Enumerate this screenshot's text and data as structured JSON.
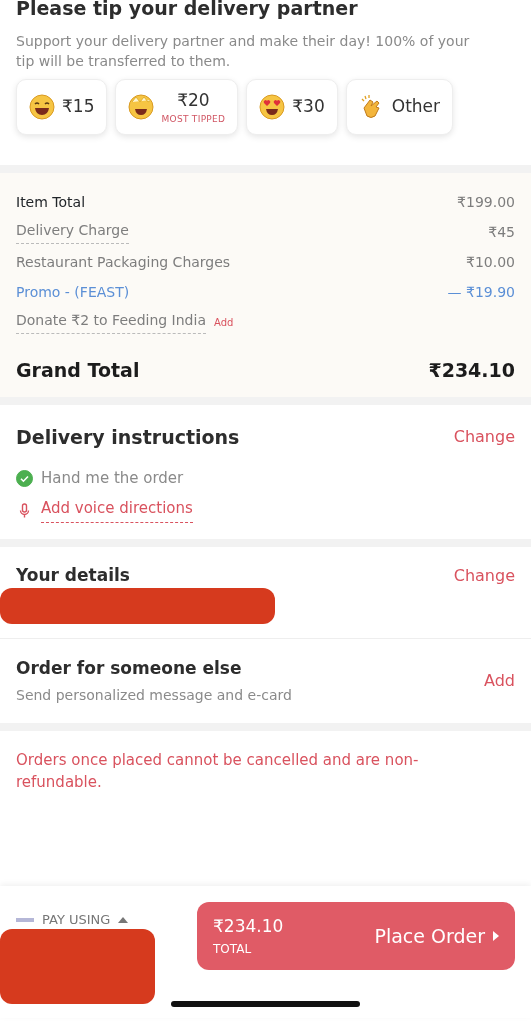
{
  "tip": {
    "title": "Please tip your delivery partner",
    "subtitle": "Support your delivery partner and make their day! 100% of your tip will be transferred to them.",
    "options": [
      {
        "kind": "laugh",
        "label": "₹15",
        "selected": false
      },
      {
        "kind": "star-eyes",
        "label": "₹20",
        "note": "MOST TIPPED",
        "selected": false
      },
      {
        "kind": "heart-eyes",
        "label": "₹30",
        "selected": false
      },
      {
        "kind": "clap",
        "label": "Other",
        "selected": false
      }
    ]
  },
  "bill": {
    "rows": [
      {
        "kind": "plain",
        "label": "Item Total",
        "value": "₹199.00"
      },
      {
        "kind": "dotted",
        "label": "Delivery Charge",
        "value": "₹45"
      },
      {
        "kind": "muted",
        "label": "Restaurant Packaging Charges",
        "value": "₹10.00"
      },
      {
        "kind": "promo",
        "label": "Promo - (FEAST)",
        "value": "— ₹19.90"
      },
      {
        "kind": "dotted",
        "label": "Donate ₹2 to Feeding India",
        "action": "Add"
      }
    ],
    "grand_total": {
      "label": "Grand Total",
      "value": "₹234.10"
    }
  },
  "delivery": {
    "title": "Delivery instructions",
    "action": "Change",
    "instruction": {
      "label": "Hand me the order",
      "checked": true
    },
    "voice": "Add voice directions"
  },
  "details": {
    "title": "Your details",
    "action": "Change"
  },
  "someone_else": {
    "title": "Order for someone else",
    "subtitle": "Send personalized message and e-card",
    "action": "Add"
  },
  "notice": "Orders once placed cannot be cancelled and are non-refundable.",
  "footer": {
    "pay_label": "PAY USING",
    "amount": "₹234.10",
    "amount_label": "TOTAL",
    "button": "Place Order"
  }
}
